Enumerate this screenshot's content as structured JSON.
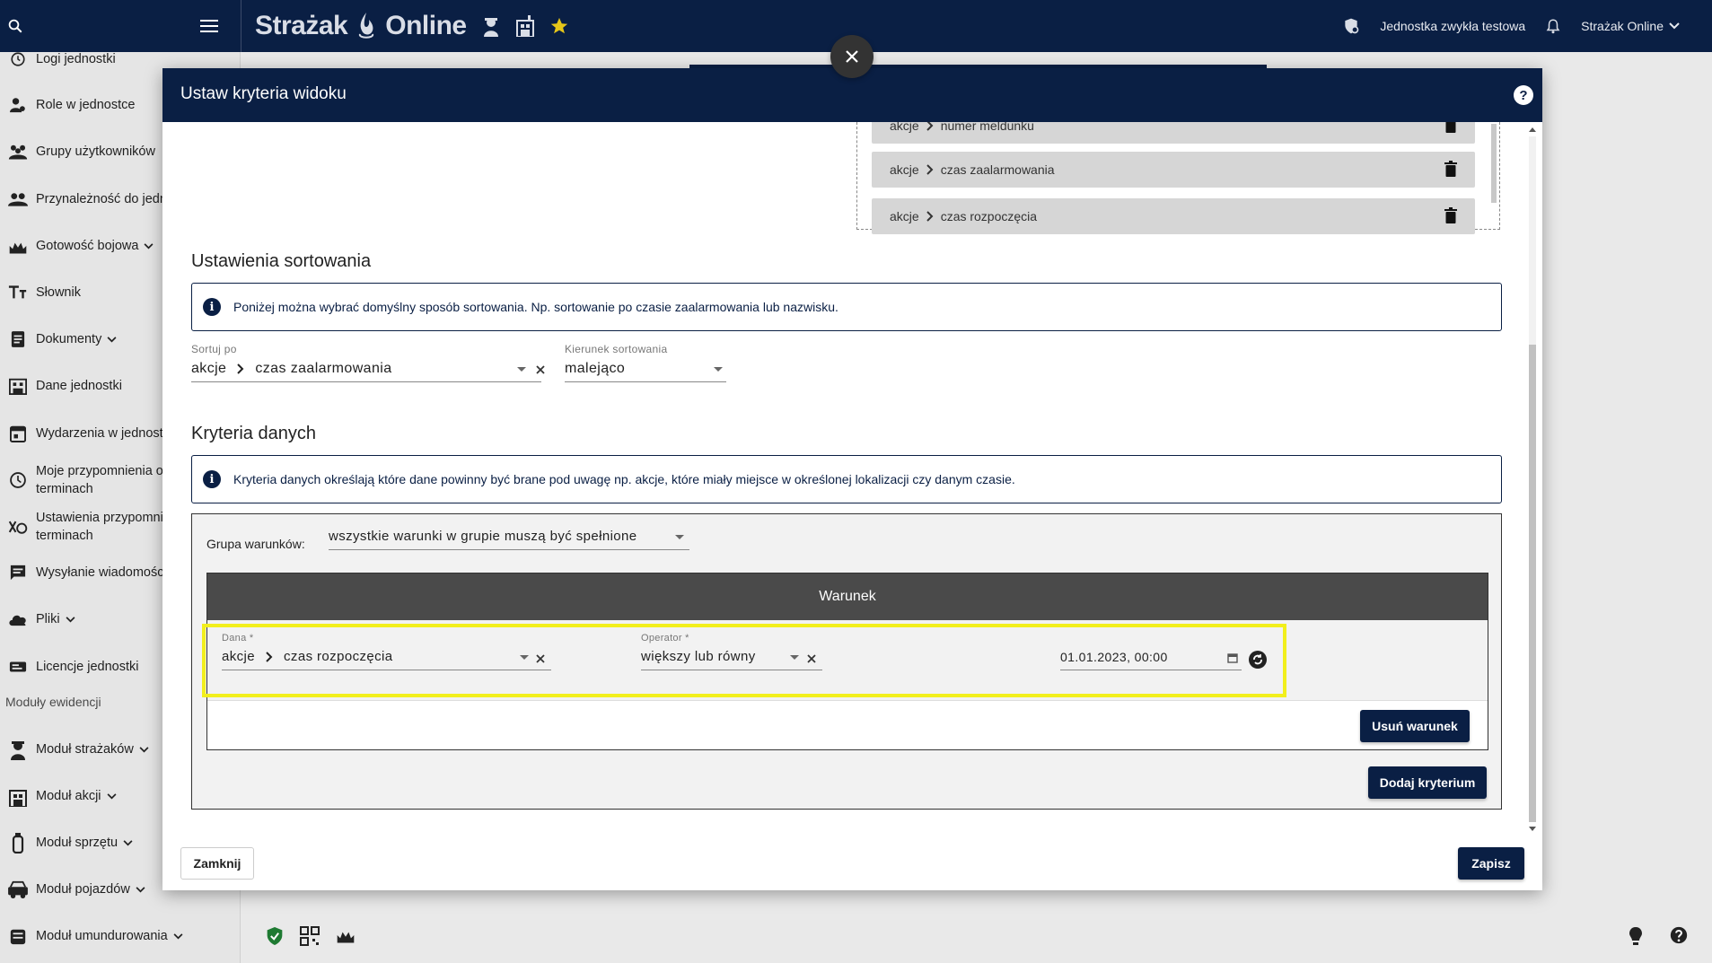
{
  "topbar": {
    "brand_left": "Strażak",
    "brand_right": "Online",
    "unit_name": "Jednostka zwykła testowa",
    "user_name": "Strażak Online"
  },
  "sidebar": {
    "items": [
      {
        "label": "Logi jednostki",
        "icon": "history-icon"
      },
      {
        "label": "Role w jednostce",
        "icon": "user-roles-icon"
      },
      {
        "label": "Grupy użytkowników",
        "icon": "groups-icon"
      },
      {
        "label": "Przynależność do jedn",
        "icon": "people-icon"
      },
      {
        "label": "Gotowość bojowa",
        "icon": "firefighter-icon"
      },
      {
        "label": "Słownik",
        "icon": "text-icon"
      },
      {
        "label": "Dokumenty",
        "icon": "document-icon"
      },
      {
        "label": "Dane jednostki",
        "icon": "building-icon"
      },
      {
        "label": "Wydarzenia w jednost",
        "icon": "calendar-icon"
      },
      {
        "label": "Moje przypomnienia o",
        "label2": "terminach",
        "icon": "clock-icon"
      },
      {
        "label": "Ustawienia przypomni",
        "label2": "terminach",
        "icon": "alarm-settings-icon"
      },
      {
        "label": "Wysyłanie wiadomośc",
        "icon": "message-icon"
      },
      {
        "label": "Pliki",
        "icon": "cloud-icon"
      },
      {
        "label": "Licencje jednostki",
        "icon": "license-icon"
      }
    ],
    "section_label": "Moduły ewidencji",
    "modules": [
      {
        "label": "Moduł strażaków",
        "icon": "firefighter-module-icon"
      },
      {
        "label": "Moduł akcji",
        "icon": "action-module-icon"
      },
      {
        "label": "Moduł sprzętu",
        "icon": "equipment-icon"
      },
      {
        "label": "Moduł pojazdów",
        "icon": "vehicle-icon"
      },
      {
        "label": "Moduł umundurowania",
        "icon": "uniform-icon"
      }
    ]
  },
  "modal": {
    "title": "Ustaw kryteria widoku",
    "help": "?",
    "chips": [
      {
        "a": "akcje",
        "b": "numer meldunku"
      },
      {
        "a": "akcje",
        "b": "czas zaalarmowania"
      },
      {
        "a": "akcje",
        "b": "czas rozpoczęcia"
      }
    ],
    "sort": {
      "title": "Ustawienia sortowania",
      "info": "Poniżej można wybrać domyślny sposób sortowania. Np. sortowanie po czasie zaalarmowania lub nazwisku.",
      "sort_by_label": "Sortuj po",
      "sort_by_a": "akcje",
      "sort_by_b": "czas zaalarmowania",
      "direction_label": "Kierunek sortowania",
      "direction_value": "malejąco"
    },
    "criteria": {
      "title": "Kryteria danych",
      "info": "Kryteria danych określają które dane powinny być brane pod uwagę np. akcje, które miały miejsce w określonej lokalizacji czy danym czasie.",
      "group_label": "Grupa warunków:",
      "group_value": "wszystkie warunki w grupie muszą być spełnione",
      "condition_header": "Warunek",
      "dana_label": "Dana *",
      "dana_a": "akcje",
      "dana_b": "czas rozpoczęcia",
      "operator_label": "Operator *",
      "operator_value": "większy lub równy",
      "date_value": "01.01.2023, 00:00",
      "remove_condition": "Usuń warunek",
      "add_criterion": "Dodaj kryterium"
    },
    "footer": {
      "close": "Zamknij",
      "save": "Zapisz"
    }
  }
}
